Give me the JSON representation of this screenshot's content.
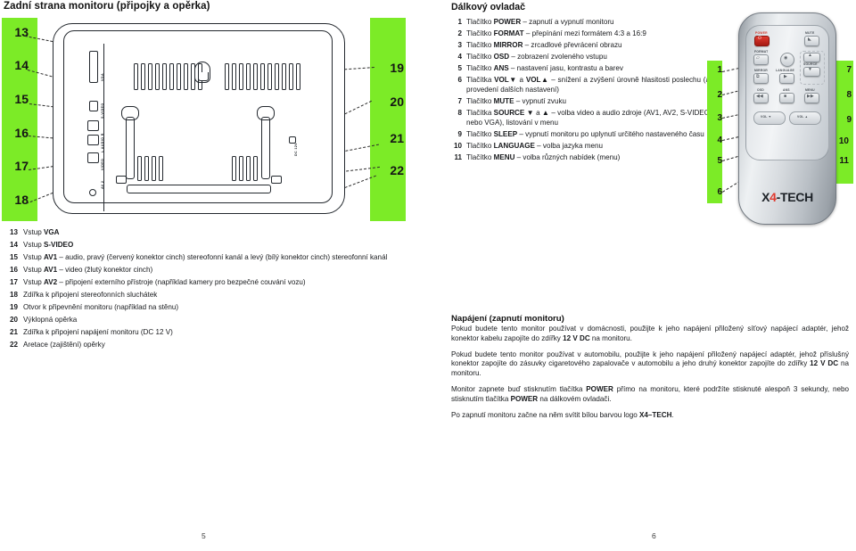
{
  "headings": {
    "left": "Zadní strana monitoru (připojky a opěrka)",
    "right": "Dálkový ovladač",
    "power": "Napájení (zapnutí monitoru)"
  },
  "colors": {
    "green_callout": "#7ceb27",
    "power_button_red": "#e03a2f",
    "text": "#17191c"
  },
  "remote_callouts_left": [
    "1",
    "2",
    "3",
    "4",
    "5",
    "6"
  ],
  "remote_callouts_right": [
    "7",
    "8",
    "9",
    "10",
    "11"
  ],
  "monitor_callouts_left": [
    "13",
    "14",
    "15",
    "16",
    "17",
    "18"
  ],
  "monitor_callouts_right": [
    "19",
    "20",
    "21",
    "22"
  ],
  "monitor_port_labels": [
    "VGA",
    "S-VIDEO",
    "L AUDIO R",
    "VIDEO",
    "AV 2",
    "DC 12V"
  ],
  "remote_buttons": [
    {
      "label": "POWER",
      "glyph": "⏻"
    },
    {
      "label": "MUTE",
      "glyph": "🔇"
    },
    {
      "label": "FORMAT",
      "glyph": "▱"
    },
    {
      "label": "",
      "glyph": "◉"
    },
    {
      "label": "MIRROR",
      "glyph": "⧉"
    },
    {
      "label": "LANGUAGE",
      "glyph": "▶"
    },
    {
      "label": "SOURCE",
      "glyph": "▲"
    },
    {
      "label": "",
      "glyph": "▼"
    },
    {
      "label": "OSD",
      "glyph": "◀◀"
    },
    {
      "label": "ANS",
      "glyph": "■"
    },
    {
      "label": "MENU",
      "glyph": "▶▶"
    },
    {
      "label": "VOL ▼",
      "glyph": ""
    },
    {
      "label": "VOL ▲",
      "glyph": ""
    }
  ],
  "remote_logo": {
    "x": "X",
    "four": "4",
    "tech": "-TECH"
  },
  "remote_list": [
    {
      "n": "1",
      "html": "Tlačítko <b>POWER</b> – zapnutí a vypnutí monitoru"
    },
    {
      "n": "2",
      "html": "Tlačítko <b>FORMAT</b> – přepínání mezi formátem 4:3 a 16:9"
    },
    {
      "n": "3",
      "html": "Tlačítko <b>MIRROR</b> – zrcadlové převrácení obrazu"
    },
    {
      "n": "4",
      "html": "Tlačítko <b>OSD</b> – zobrazení zvoleného vstupu"
    },
    {
      "n": "5",
      "html": "Tlačítko <b>ANS</b> – nastavení jasu, kontrastu a barev"
    },
    {
      "n": "6",
      "html": "Tlačítka <b>VOL▼</b> a <b>VOL▲</b> – snížení a zvýšení úrovně hlasitosti poslechu (a provedení dalších nastavení)"
    },
    {
      "n": "7",
      "html": "Tlačítko <b>MUTE</b> – vypnutí zvuku"
    },
    {
      "n": "8",
      "html": "Tlačítka <b>SOURCE ▼</b> a <b>▲</b> – volba video a audio zdroje (AV1, AV2, S-VIDEO nebo VGA), listování v menu"
    },
    {
      "n": "9",
      "html": "Tlačítko <b>SLEEP</b> – vypnutí monitoru po uplynutí určitého nastaveného času"
    },
    {
      "n": "10",
      "html": "Tlačítko <b>LANGUAGE</b> – volba jazyka menu"
    },
    {
      "n": "11",
      "html": "Tlačítko <b>MENU</b> – volba různých nabídek (menu)"
    }
  ],
  "monitor_list": [
    {
      "n": "13",
      "html": "Vstup <b>VGA</b>"
    },
    {
      "n": "14",
      "html": "Vstup <b>S-VIDEO</b>"
    },
    {
      "n": "15",
      "html": "Vstup <b>AV1</b> – audio, pravý (červený konektor cinch) stereofonní kanál a levý (bílý konektor cinch) stereofonní kanál"
    },
    {
      "n": "16",
      "html": "Vstup <b>AV1</b> – video (žlutý konektor cinch)"
    },
    {
      "n": "17",
      "html": "Vstup <b>AV2</b> – připojení externího přístroje (například kamery pro bezpečné couvání vozu)"
    },
    {
      "n": "18",
      "html": "Zdířka k připojení stereofonních sluchátek"
    },
    {
      "n": "19",
      "html": "Otvor k připevnění monitoru (například na stěnu)"
    },
    {
      "n": "20",
      "html": "Výklopná opěrka"
    },
    {
      "n": "21",
      "html": "Zdířka k připojení napájení monitoru (DC 12 V)"
    },
    {
      "n": "22",
      "html": "Aretace (zajištění) opěrky"
    }
  ],
  "power_paragraphs": [
    "Pokud budete tento monitor používat v domácnosti, použijte k jeho napájení přiložený síťový napájecí adaptér, jehož konektor kabelu zapojíte do zdířky <b>12 V DC</b> na monitoru.",
    "Pokud budete tento monitor používat v automobilu, použijte k jeho napájení přiložený napájecí adaptér, jehož příslušný konektor zapojíte do zásuvky cigaretového zapalovače v automobilu a jeho druhý konektor zapojíte do zdířky <b>12 V DC</b> na monitoru.",
    "Monitor zapnete buď stisknutím tlačítka <b>POWER</b> přímo na monitoru, které podržíte stisknuté alespoň 3 sekundy, nebo stisknutím tlačítka <b>POWER</b> na dálkovém ovladači.",
    "Po zapnutí monitoru začne na něm svítit bílou barvou logo <b>X4–TECH</b>."
  ],
  "footer": {
    "page_left": "5",
    "page_right": "6"
  }
}
